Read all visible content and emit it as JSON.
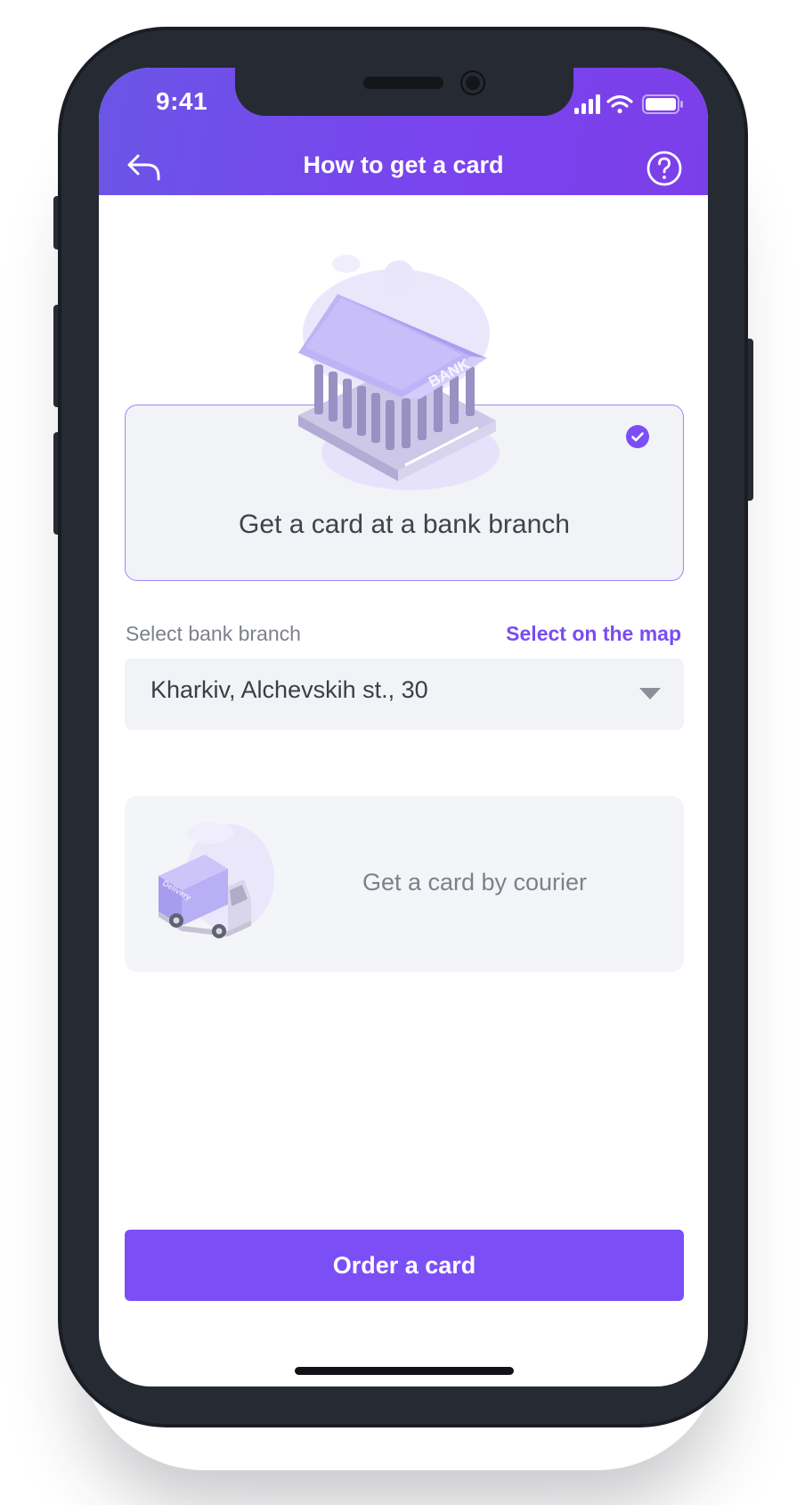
{
  "status_bar": {
    "time": "9:41",
    "icons": [
      "signal-icon",
      "wifi-icon",
      "battery-icon"
    ]
  },
  "nav": {
    "title": "How to get a card",
    "back_icon": "back-arrow-icon",
    "help_icon": "question-circle-icon"
  },
  "delivery_options": [
    {
      "title": "Get a card at a bank branch",
      "illustration": "bank-building-illustration",
      "illustration_text": "BANK",
      "selected": true
    },
    {
      "title": "Get a card by courier",
      "illustration": "delivery-truck-illustration",
      "illustration_text": "Delivery",
      "selected": false
    }
  ],
  "branch_select": {
    "label": "Select bank branch",
    "map_link": "Select on the map",
    "value": "Kharkiv, Alchevskih st., 30"
  },
  "order_button": {
    "label": "Order a card"
  },
  "colors": {
    "accent": "#7b4ff5",
    "header_start": "#6a55e6",
    "header_end": "#7b3fe9",
    "phone_frame": "#262a33",
    "card_bg": "#f2f3f7"
  }
}
